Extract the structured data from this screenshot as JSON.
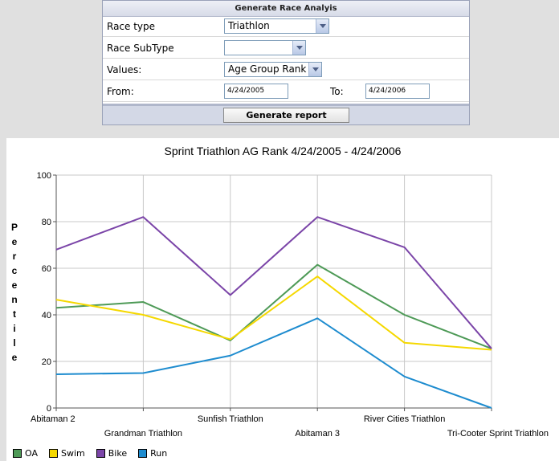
{
  "form": {
    "header": "Generate Race Analyis",
    "race_type_label": "Race type",
    "race_type_value": "Triathlon",
    "race_subtype_label": "Race SubType",
    "race_subtype_value": "",
    "values_label": "Values:",
    "values_value": "Age Group Rank",
    "from_label": "From:",
    "from_value": "4/24/2005",
    "to_label": "To:",
    "to_value": "4/24/2006",
    "generate_label": "Generate report"
  },
  "chart_data": {
    "type": "line",
    "title": "Sprint Triathlon AG Rank  4/24/2005 - 4/24/2006",
    "ylabel": "Percentile",
    "xlabel": "",
    "ylim": [
      0,
      100
    ],
    "yticks": [
      0,
      20,
      40,
      60,
      80,
      100
    ],
    "categories": [
      "Abitaman 2",
      "Grandman Triathlon",
      "Sunfish Triathlon",
      "Abitaman 3",
      "River Cities Triathlon",
      "Tri-Cooter Sprint Triathlon"
    ],
    "grid": true,
    "legend": "bottom-left",
    "series": [
      {
        "name": "OA",
        "color": "#4e9a57",
        "values": [
          43,
          45.5,
          29,
          61.5,
          40,
          25.5
        ]
      },
      {
        "name": "Swim",
        "color": "#f5d800",
        "values": [
          46.5,
          40,
          29.5,
          56.5,
          28,
          25
        ]
      },
      {
        "name": "Bike",
        "color": "#7b45a8",
        "values": [
          68,
          82,
          48.5,
          82,
          69,
          25.5
        ]
      },
      {
        "name": "Run",
        "color": "#1e8ccf",
        "values": [
          14.5,
          15,
          22.5,
          38.5,
          13.5,
          0
        ]
      }
    ]
  }
}
